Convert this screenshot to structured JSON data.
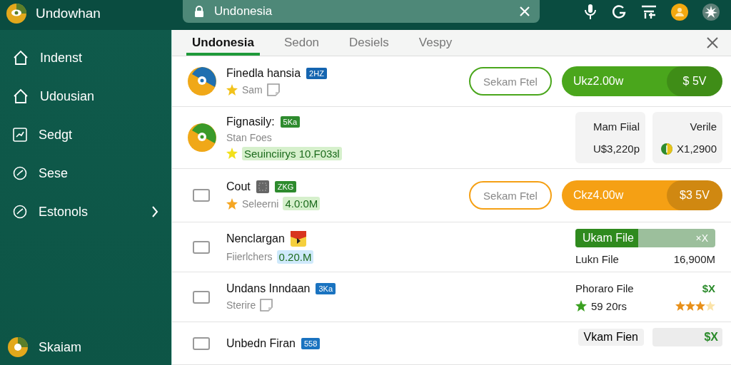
{
  "app": {
    "title": "Undowhan"
  },
  "search": {
    "value": "Undonesia"
  },
  "sidebar": {
    "items": [
      {
        "label": "Indenst",
        "kind": "home"
      },
      {
        "label": "Udousian",
        "kind": "home"
      },
      {
        "label": "Sedgt",
        "kind": "chart"
      },
      {
        "label": "Sese",
        "kind": "gauge"
      },
      {
        "label": "Estonols",
        "kind": "gauge",
        "has_submenu": true
      }
    ],
    "user": {
      "name": "Skaiam"
    }
  },
  "tabs": [
    {
      "label": "Undonesia",
      "selected": true
    },
    {
      "label": "Sedon",
      "selected": false
    },
    {
      "label": "Desiels",
      "selected": false
    },
    {
      "label": "Vespy",
      "selected": false
    }
  ],
  "rows": [
    {
      "lead": {
        "kind": "logo",
        "color": "#1f6fb0"
      },
      "title": "Finedla hansia",
      "extras": [
        {
          "kind": "tag",
          "text": "2HZ",
          "color": "#1565b0"
        }
      ],
      "lines": [
        [
          {
            "kind": "star",
            "color": "#f2c21b"
          },
          {
            "kind": "text",
            "text": "Sam"
          },
          {
            "kind": "note"
          }
        ]
      ],
      "aside": {
        "kind": "actions",
        "outline": "Sekam Ftel",
        "pill": "Ukz2.00w",
        "pill_end": "$ 5V",
        "color": "#4aa61c"
      }
    },
    {
      "lead": {
        "kind": "logo",
        "color": "#3a9a2a"
      },
      "title": "Fignasily:",
      "extras": [
        {
          "kind": "tag",
          "text": "5Ka",
          "color": "#2e8b2e"
        }
      ],
      "lines": [
        [
          {
            "kind": "text",
            "text": "Stan Foes"
          }
        ],
        [
          {
            "kind": "star",
            "color": "#f2e01b"
          },
          {
            "kind": "chip",
            "text": "Seuinciirys 10.F03ɜl",
            "color": "#d6f0cc"
          }
        ]
      ],
      "aside": {
        "kind": "cards",
        "cards": [
          {
            "label": "Mam Fiial",
            "value": "U$3,220p",
            "kind": "plain"
          },
          {
            "label": "Verile",
            "value": "X1,2900",
            "kind": "with-icon"
          }
        ]
      }
    },
    {
      "lead": {
        "kind": "checkbox",
        "checked": false
      },
      "title": "Cout",
      "extras": [
        {
          "kind": "square"
        },
        {
          "kind": "tag",
          "text": "ZKG",
          "color": "#2e8b2e"
        }
      ],
      "lines": [
        [
          {
            "kind": "star",
            "color": "#f5a623"
          },
          {
            "kind": "text",
            "text": "Seleerni"
          },
          {
            "kind": "chip",
            "text": "4.0:0M",
            "color": "#d6f0cc"
          }
        ]
      ],
      "aside": {
        "kind": "actions",
        "outline": "Sekam Ftel",
        "pill": "Ckz4.00w",
        "pill_end": "$3 5V",
        "color": "#f5a014"
      }
    },
    {
      "lead": {
        "kind": "checkbox",
        "checked": false
      },
      "title": "Nenclargan",
      "extras": [
        {
          "kind": "flag"
        }
      ],
      "lines": [
        [
          {
            "kind": "text",
            "text": "Fiierlchers"
          },
          {
            "kind": "chip",
            "text": "0.20.M",
            "color": "#cfe9fb"
          }
        ]
      ],
      "aside": {
        "kind": "progress",
        "label": "Ukam File",
        "level": 0.45,
        "end": "×X",
        "caption": "Lukn File",
        "amount": "16,900M"
      }
    },
    {
      "lead": {
        "kind": "checkbox",
        "checked": false
      },
      "title": "Undans Inndaan",
      "extras": [
        {
          "kind": "tag",
          "text": "3Ka",
          "color": "#1a73c0"
        }
      ],
      "lines": [
        [
          {
            "kind": "text",
            "text": "Sterire"
          },
          {
            "kind": "note"
          }
        ]
      ],
      "aside": {
        "kind": "rating",
        "label": "Phoraro File",
        "mark": "$X",
        "count": "59 20rs",
        "stars": 3
      }
    },
    {
      "lead": {
        "kind": "checkbox",
        "checked": false
      },
      "title": "Unbedn Firan",
      "extras": [
        {
          "kind": "tag",
          "text": "558",
          "color": "#1a73c0"
        }
      ],
      "aside": {
        "kind": "bar",
        "label": "Vkam Fien",
        "mark": "$X"
      }
    }
  ]
}
